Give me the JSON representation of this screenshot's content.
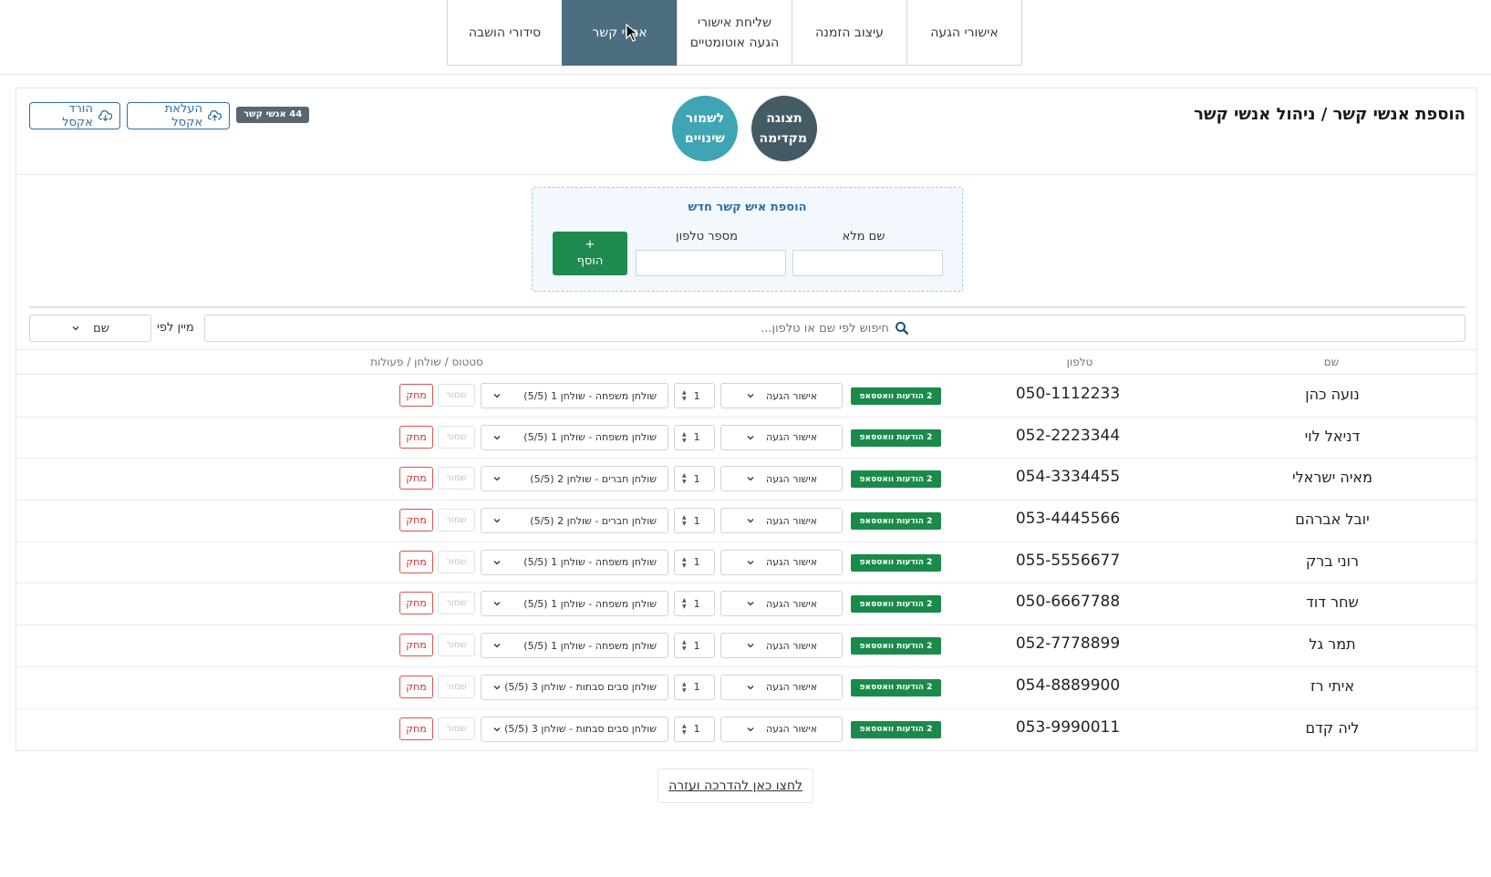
{
  "tabs": [
    {
      "label": "סידורי הושבה"
    },
    {
      "label": "אנשי קשר"
    },
    {
      "label": "שליחת אישורי הגעה אוטומטיים"
    },
    {
      "label": "עיצוב הזמנה"
    },
    {
      "label": "אישורי הגעה"
    }
  ],
  "header": {
    "title": "הוספת אנשי קשר / ניהול אנשי קשר",
    "preview_button": "תצוגה מקדימה",
    "save_button": "לשמור שינויים",
    "count_badge": "44 אנשי קשר",
    "upload_excel": "העלאת אקסל",
    "download_excel": "הורד אקסל"
  },
  "add_contact": {
    "title": "הוספת איש קשר חדש",
    "full_name_label": "שם מלא",
    "phone_label": "מספר טלפון",
    "add_button_plus": "+",
    "add_button": "הוסף",
    "full_name_value": "",
    "phone_value": ""
  },
  "search": {
    "placeholder": "חיפוש לפי שם או טלפון..."
  },
  "sort": {
    "label": "מיין לפי",
    "selected": "שם"
  },
  "table": {
    "headers": {
      "name": "שם",
      "phone": "טלפון",
      "status": "סטטוס / שולחן / פעולות"
    },
    "rows": [
      {
        "name": "נועה כהן",
        "phone": "050-1112233",
        "badge": "2 הודעות וואטסאפ",
        "status": "אישור הגעה",
        "count": "1",
        "table": "שולחן משפחה - שולחן 1 (5/5)",
        "save": "שמור",
        "delete": "מחק"
      },
      {
        "name": "דניאל לוי",
        "phone": "052-2223344",
        "badge": "2 הודעות וואטסאפ",
        "status": "אישור הגעה",
        "count": "1",
        "table": "שולחן משפחה - שולחן 1 (5/5)",
        "save": "שמור",
        "delete": "מחק"
      },
      {
        "name": "מאיה ישראלי",
        "phone": "054-3334455",
        "badge": "2 הודעות וואטסאפ",
        "status": "אישור הגעה",
        "count": "1",
        "table": "שולחן חברים - שולחן 2 (5/5)",
        "save": "שמור",
        "delete": "מחק"
      },
      {
        "name": "יובל אברהם",
        "phone": "053-4445566",
        "badge": "2 הודעות וואטסאפ",
        "status": "אישור הגעה",
        "count": "1",
        "table": "שולחן חברים - שולחן 2 (5/5)",
        "save": "שמור",
        "delete": "מחק"
      },
      {
        "name": "רוני ברק",
        "phone": "055-5556677",
        "badge": "2 הודעות וואטסאפ",
        "status": "אישור הגעה",
        "count": "1",
        "table": "שולחן משפחה - שולחן 1 (5/5)",
        "save": "שמור",
        "delete": "מחק"
      },
      {
        "name": "שחר דוד",
        "phone": "050-6667788",
        "badge": "2 הודעות וואטסאפ",
        "status": "אישור הגעה",
        "count": "1",
        "table": "שולחן משפחה - שולחן 1 (5/5)",
        "save": "שמור",
        "delete": "מחק"
      },
      {
        "name": "תמר גל",
        "phone": "052-7778899",
        "badge": "2 הודעות וואטסאפ",
        "status": "אישור הגעה",
        "count": "1",
        "table": "שולחן משפחה - שולחן 1 (5/5)",
        "save": "שמור",
        "delete": "מחק"
      },
      {
        "name": "איתי רז",
        "phone": "054-8889900",
        "badge": "2 הודעות וואטסאפ",
        "status": "אישור הגעה",
        "count": "1",
        "table": "שולחן סבים סבתות - שולחן 3 (5/5)",
        "save": "שמור",
        "delete": "מחק"
      },
      {
        "name": "ליה קדם",
        "phone": "053-9990011",
        "badge": "2 הודעות וואטסאפ",
        "status": "אישור הגעה",
        "count": "1",
        "table": "שולחן סבים סבתות - שולחן 3 (5/5)",
        "save": "שמור",
        "delete": "מחק"
      }
    ]
  },
  "help_link": "לחצו כאן להדרכה ועזרה",
  "icons": {
    "upload": "cloud-upload-icon",
    "download": "cloud-download-icon",
    "search": "search-icon",
    "chevron": "chevron-down-icon",
    "cursor": "mouse-pointer-icon"
  },
  "colors": {
    "active_tab": "#4d6d80",
    "preview_circle": "#445a64",
    "save_circle": "#3fa4b4",
    "add_button": "#1e8a4f",
    "whatsapp_badge": "#1a8a4a",
    "delete": "#c9302c",
    "link_blue": "#2f6ea4"
  }
}
